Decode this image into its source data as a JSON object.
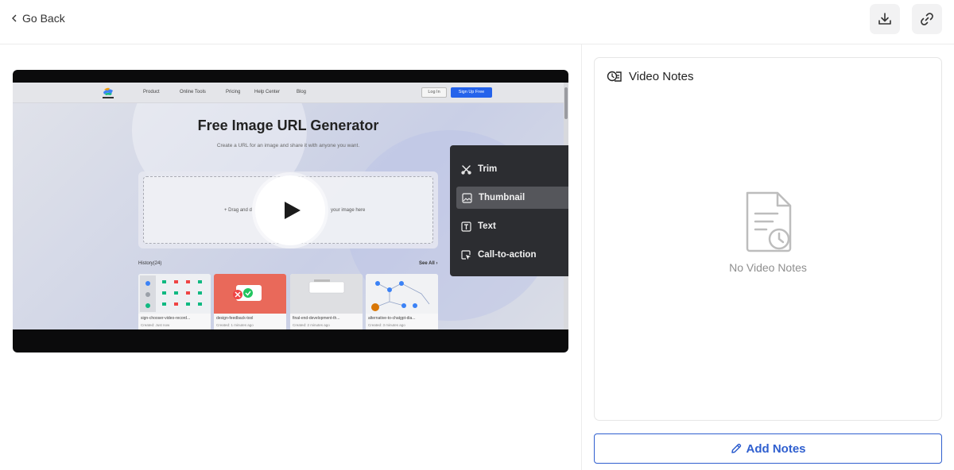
{
  "topbar": {
    "back_label": "Go Back",
    "download_icon": "download-icon",
    "link_icon": "link-icon"
  },
  "video": {
    "site": {
      "nav": [
        "Product",
        "Online Tools",
        "Pricing",
        "Help Center",
        "Blog"
      ],
      "login_label": "Log In",
      "signup_label": "Sign Up Free",
      "title": "Free Image URL Generator",
      "subtitle": "Create a URL for an image and share it with anyone you want.",
      "drop_left": "+ Drag and d",
      "drop_right": "your image here",
      "history_label": "History(24)",
      "see_all_label": "See All ›",
      "history": [
        {
          "title": "sign-chooser-video-record...",
          "date": "Created: Just now"
        },
        {
          "title": "design-feedback-tool",
          "date": "Created: 1 minutes ago"
        },
        {
          "title": "final-end-development-th...",
          "date": "Created: 2 minutes ago"
        },
        {
          "title": "alternative-to-chatgpt-dia...",
          "date": "Created: 3 minutes ago"
        }
      ]
    },
    "menu": [
      {
        "label": "Trim",
        "icon": "scissors-icon",
        "active": false
      },
      {
        "label": "Thumbnail",
        "icon": "image-icon",
        "active": true
      },
      {
        "label": "Text",
        "icon": "text-icon",
        "active": false
      },
      {
        "label": "Call-to-action",
        "icon": "cursor-click-icon",
        "active": false
      }
    ],
    "colors": {
      "accent": "#2563eb",
      "menu_bg": "#2c2d31"
    }
  },
  "notes": {
    "title": "Video Notes",
    "empty_text": "No Video Notes",
    "add_label": "Add Notes",
    "accent": "#2f5fcf"
  }
}
